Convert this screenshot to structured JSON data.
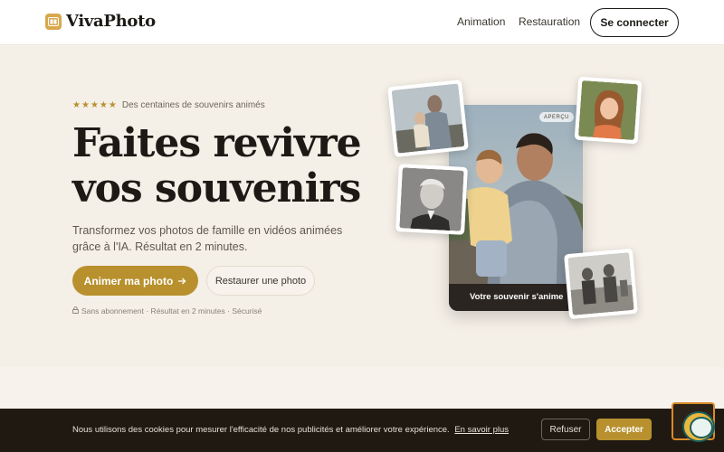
{
  "header": {
    "logo_text": "VivaPhoto",
    "nav": [
      {
        "label": "Animation"
      },
      {
        "label": "Restauration"
      }
    ],
    "connect_label": "Se connecter"
  },
  "hero": {
    "rating_stars": 5,
    "rating_text": "Des centaines de souvenirs animés",
    "title_line1": "Faites revivre",
    "title_line2": "vos souvenirs",
    "subtitle": "Transformez vos photos de famille en vidéos animées grâce à l'IA. Résultat en 2 minutes.",
    "cta_primary": "Animer ma photo",
    "cta_secondary": "Restaurer une photo",
    "reassurance": "Sans abonnement · Résultat en 2 minutes · Sécurisé"
  },
  "preview": {
    "badge": "APERÇU",
    "caption": "Votre souvenir s'anime"
  },
  "cookie": {
    "text": "Nous utilisons des cookies pour mesurer l'efficacité de nos publicités et améliorer votre expérience.",
    "link": "En savoir plus",
    "refuse": "Refuser",
    "accept": "Accepter"
  },
  "colors": {
    "accent": "#b8912e",
    "background": "#f4efe7",
    "dark": "#1f1912"
  },
  "icons": [
    "logo-icon",
    "star-icon",
    "arrow-right-icon",
    "lock-icon",
    "chat-widget-icon"
  ]
}
